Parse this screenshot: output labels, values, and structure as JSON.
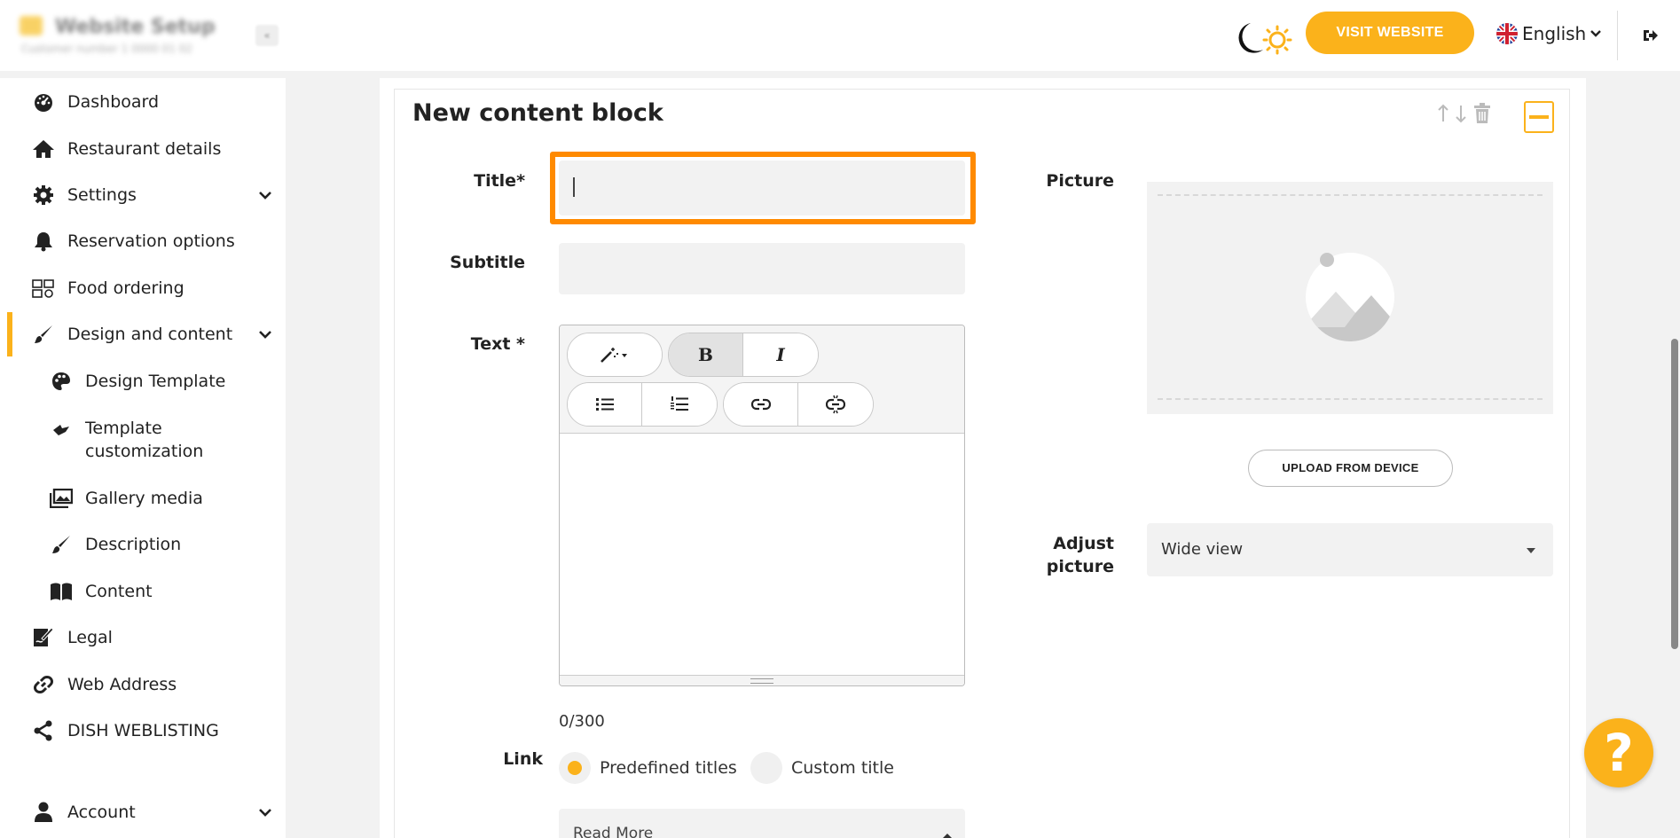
{
  "header": {
    "app_title": "Website Setup",
    "app_subtitle": "Customer number 1 0000 01 02",
    "collapse_glyph": "«",
    "visit_website_label": "VISIT WEBSITE",
    "language_label": "English",
    "icons": [
      "moon-icon",
      "sun-icon",
      "uk-flag-icon",
      "chevron-down-icon",
      "logout-icon"
    ]
  },
  "sidebar": {
    "items": [
      {
        "label": "Dashboard",
        "icon": "dashboard-icon"
      },
      {
        "label": "Restaurant details",
        "icon": "home-icon"
      },
      {
        "label": "Settings",
        "icon": "gear-icon",
        "expandable": true
      },
      {
        "label": "Reservation options",
        "icon": "bell-icon"
      },
      {
        "label": "Food ordering",
        "icon": "food-ordering-icon"
      },
      {
        "label": "Design and content",
        "icon": "brush-icon",
        "expandable": true,
        "active": true
      },
      {
        "label": "Design Template",
        "icon": "palette-icon",
        "sub": true
      },
      {
        "label": "Template customization",
        "line1": "Template",
        "line2": "customization",
        "icon": "template-customization-icon",
        "sub": true
      },
      {
        "label": "Gallery media",
        "icon": "gallery-icon",
        "sub": true
      },
      {
        "label": "Description",
        "icon": "brush-icon",
        "sub": true
      },
      {
        "label": "Content",
        "icon": "book-icon",
        "sub": true
      },
      {
        "label": "Legal",
        "icon": "legal-icon"
      },
      {
        "label": "Web Address",
        "icon": "link-icon"
      },
      {
        "label": "DISH WEBLISTING",
        "icon": "share-icon"
      },
      {
        "label": "Account",
        "icon": "user-icon",
        "expandable": true
      }
    ]
  },
  "block": {
    "title": "New content block",
    "fields": {
      "title_label": "Title*",
      "title_value": "",
      "subtitle_label": "Subtitle",
      "subtitle_value": "",
      "text_label": "Text *",
      "counter": "0/300",
      "link_label": "Link",
      "radio_predefined": "Predefined titles",
      "radio_custom": "Custom title",
      "link_select_value": "Read More"
    },
    "editor_toolbar": {
      "bold": "B",
      "italic": "I"
    },
    "picture": {
      "label": "Picture",
      "upload_label": "UPLOAD FROM DEVICE",
      "adjust_label_1": "Adjust",
      "adjust_label_2": "picture",
      "adjust_value": "Wide view"
    }
  },
  "colors": {
    "accent": "#fbb21b",
    "highlight": "#ff8a00"
  },
  "help": {
    "glyph": "?"
  }
}
